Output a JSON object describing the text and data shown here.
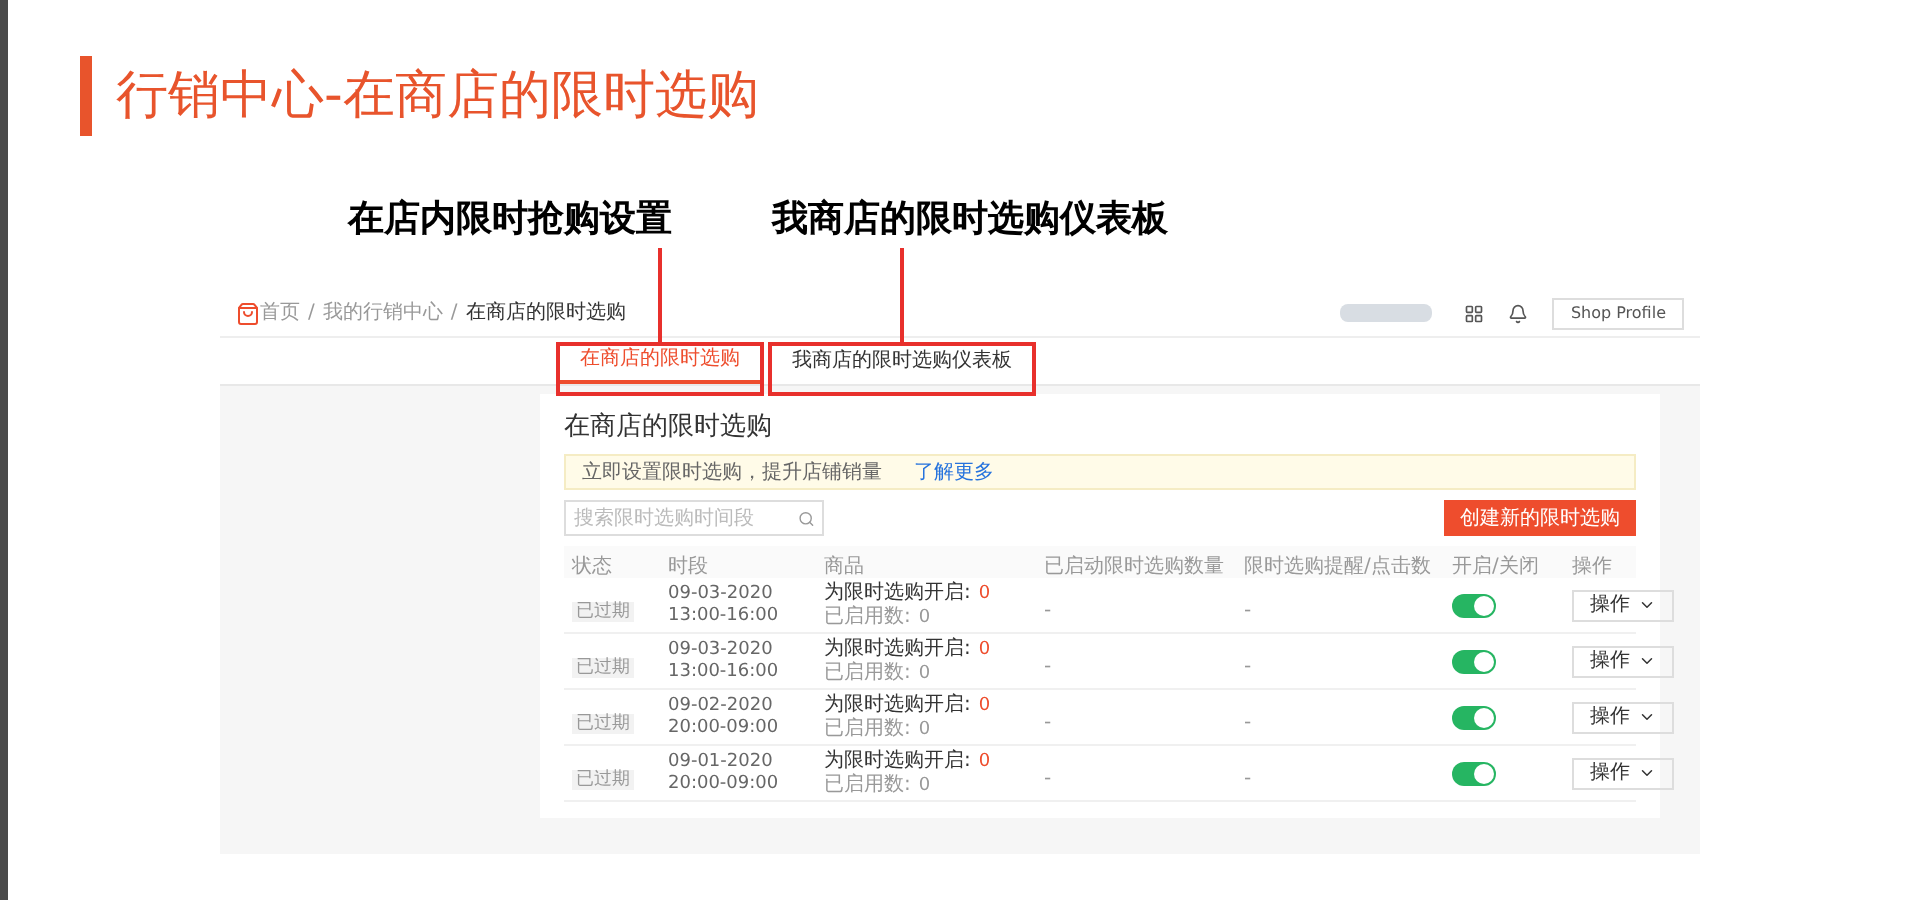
{
  "title": "行销中心-在商店的限时选购",
  "annotations": [
    "在店内限时抢购设置",
    "我商店的限时选购仪表板"
  ],
  "topbar": {
    "breadcrumb": [
      "首页",
      "我的行销中心",
      "在商店的限时选购"
    ],
    "separator": "/",
    "button": "Shop Profile"
  },
  "tabs": [
    {
      "label": "在商店的限时选购",
      "selected": true
    },
    {
      "label": "我商店的限时选购仪表板",
      "selected": false
    }
  ],
  "card": {
    "title": "在商店的限时选购",
    "notice": "立即设置限时选购，提升店铺销量",
    "notice_link": "了解更多",
    "search": {
      "placeholder": "搜索限时选购时间段"
    },
    "create_button": "创建新的限时选购"
  },
  "table": {
    "columns": [
      "状态",
      "时段",
      "商品",
      "已启动限时选购数量",
      "限时选购提醒/点击数",
      "开启/关闭",
      "操作"
    ],
    "rows": [
      {
        "status": "已过期",
        "date": "09-03-2020",
        "time": "13:00-16:00",
        "product_label": "为限时选购开启:",
        "product_count": "0",
        "enabled_label": "已启用数:",
        "enabled_count": "0",
        "column_4": "-",
        "column_5": "-",
        "on": true,
        "action": "操作"
      },
      {
        "status": "已过期",
        "date": "09-03-2020",
        "time": "13:00-16:00",
        "product_label": "为限时选购开启:",
        "product_count": "0",
        "enabled_label": "已启用数:",
        "enabled_count": "0",
        "column_4": "-",
        "column_5": "-",
        "on": true,
        "action": "操作"
      },
      {
        "status": "已过期",
        "date": "09-02-2020",
        "time": "20:00-09:00",
        "product_label": "为限时选购开启:",
        "product_count": "0",
        "enabled_label": "已启用数:",
        "enabled_count": "0",
        "column_4": "-",
        "column_5": "-",
        "on": true,
        "action": "操作"
      },
      {
        "status": "已过期",
        "date": "09-01-2020",
        "time": "20:00-09:00",
        "product_label": "为限时选购开启:",
        "product_count": "0",
        "enabled_label": "已启用数:",
        "enabled_count": "0",
        "column_4": "-",
        "column_5": "-",
        "on": true,
        "action": "操作"
      }
    ]
  }
}
